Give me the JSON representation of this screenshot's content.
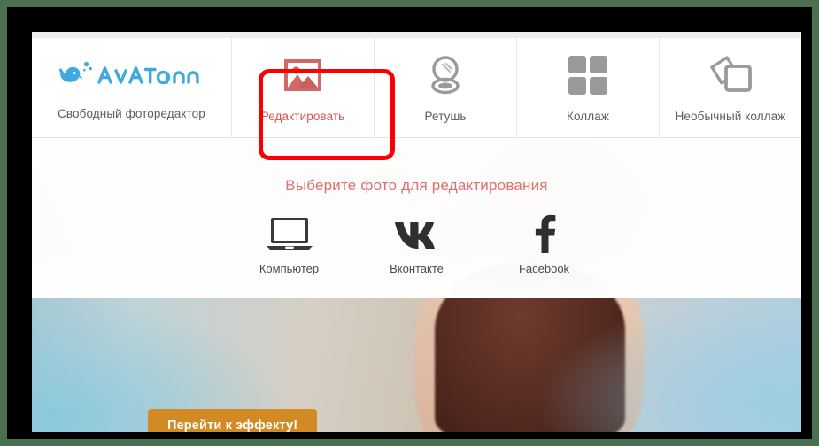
{
  "colors": {
    "brand_blue": "#3fa9e0",
    "accent_red": "#d9534f",
    "highlight_red": "#fb0000",
    "cta_orange": "#d18a24",
    "icon_gray": "#9a9a9a",
    "title_salmon": "#e06f6f"
  },
  "header": {
    "brand": {
      "logo_icon": "whale-icon",
      "wordmark": "avatan",
      "tagline": "Свободный фоторедактор"
    },
    "tabs": [
      {
        "id": "edit",
        "label": "Редактировать",
        "icon": "picture-icon",
        "active": true
      },
      {
        "id": "retouch",
        "label": "Ретушь",
        "icon": "powder-compact-icon",
        "active": false
      },
      {
        "id": "collage",
        "label": "Коллаж",
        "icon": "grid-four-squares-icon",
        "active": false
      },
      {
        "id": "fancy-collage",
        "label": "Необычный коллаж",
        "icon": "stacked-frames-icon",
        "active": false
      }
    ]
  },
  "stage": {
    "picker": {
      "title": "Выберите фото для редактирования",
      "sources": [
        {
          "id": "computer",
          "label": "Компьютер",
          "icon": "laptop-icon"
        },
        {
          "id": "vk",
          "label": "Вконтакте",
          "icon": "vk-icon"
        },
        {
          "id": "facebook",
          "label": "Facebook",
          "icon": "facebook-icon"
        }
      ]
    },
    "cta_label": "Перейти к эффекту!"
  }
}
